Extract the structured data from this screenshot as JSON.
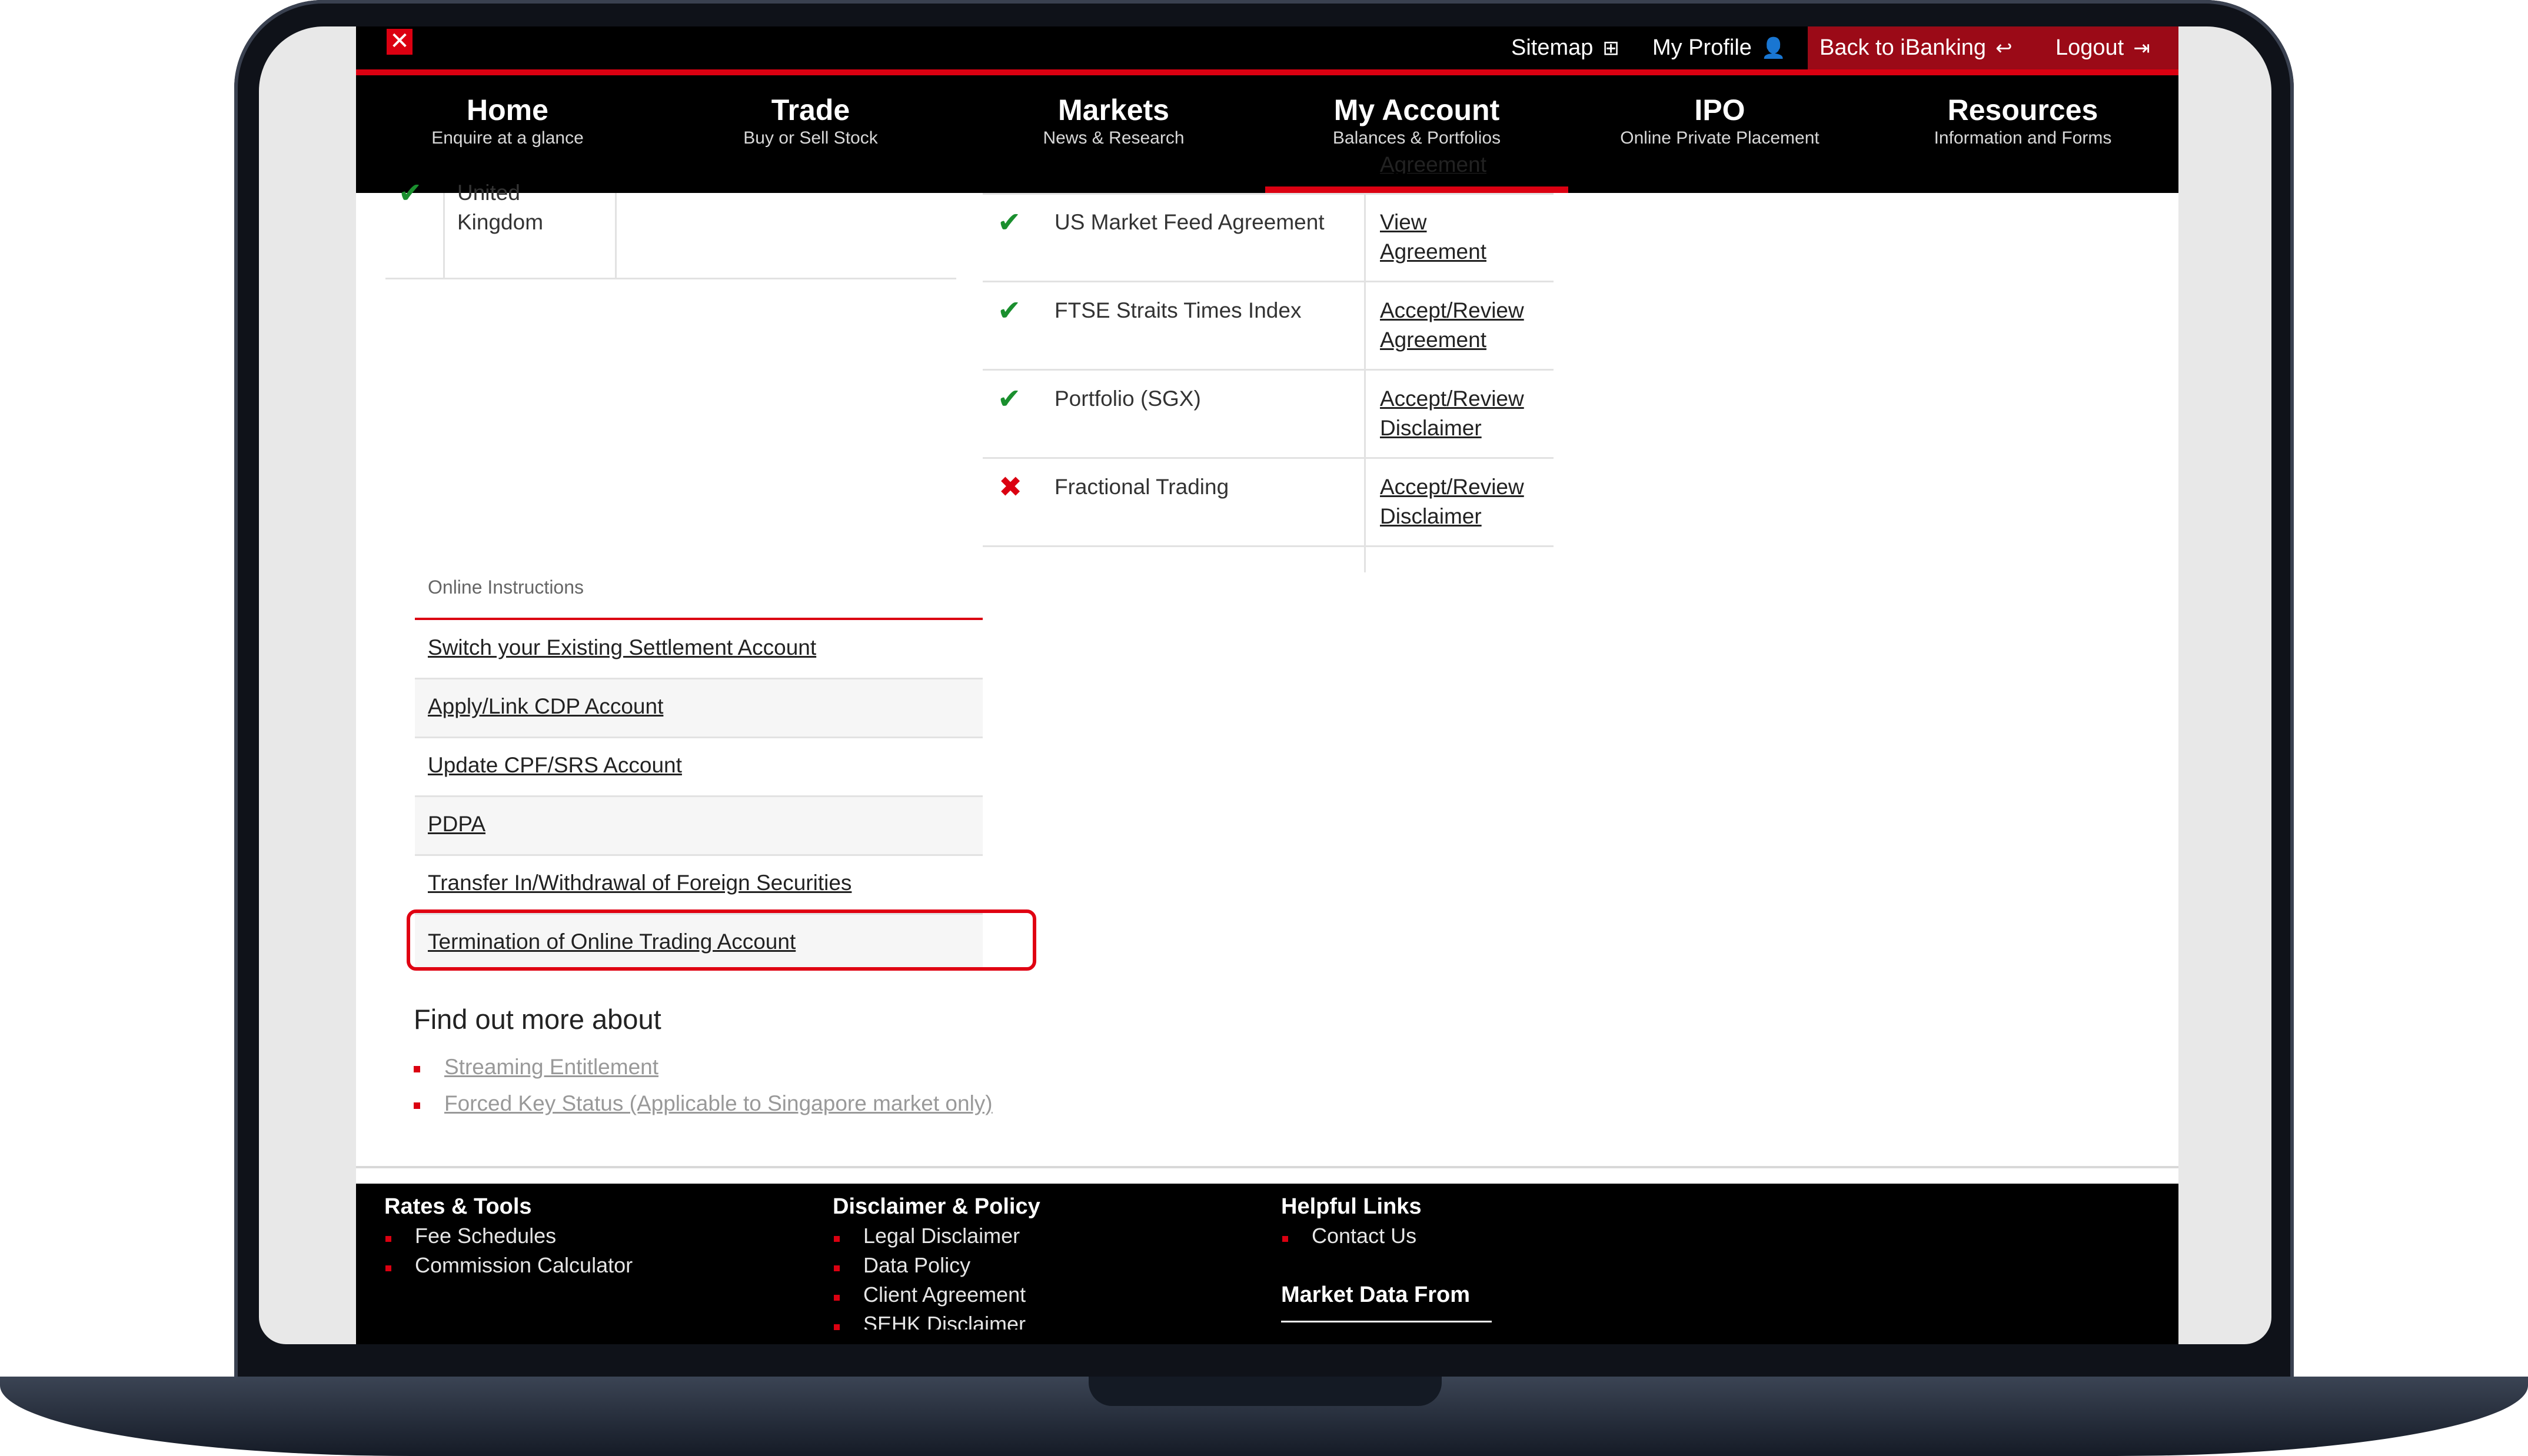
{
  "topbar": {
    "logo_icon": "hsbc-hexagon-icon",
    "sitemap": "Sitemap",
    "sitemap_icon": "sitemap-icon",
    "profile": "My Profile",
    "profile_icon": "user-icon",
    "back": "Back to iBanking",
    "back_icon": "reply-arrow-icon",
    "logout": "Logout",
    "logout_icon": "logout-icon"
  },
  "nav": [
    {
      "title": "Home",
      "subtitle": "Enquire at a glance"
    },
    {
      "title": "Trade",
      "subtitle": "Buy or Sell Stock"
    },
    {
      "title": "Markets",
      "subtitle": "News & Research"
    },
    {
      "title": "My Account",
      "subtitle": "Balances & Portfolios",
      "active": true
    },
    {
      "title": "IPO",
      "subtitle": "Online Private Placement"
    },
    {
      "title": "Resources",
      "subtitle": "Information and Forms"
    }
  ],
  "markets_partial": {
    "status": "check",
    "name_line1": "United",
    "name_line2": "Kingdom"
  },
  "agreements_partial_link": "Agreement",
  "agreements": [
    {
      "status": "check",
      "name": "US Market Feed Agreement",
      "link_line1": "View",
      "link_line2": "Agreement"
    },
    {
      "status": "check",
      "name": "FTSE Straits Times Index",
      "link_line1": "Accept/Review",
      "link_line2": "Agreement"
    },
    {
      "status": "check",
      "name": "Portfolio (SGX)",
      "link_line1": "Accept/Review",
      "link_line2": "Disclaimer"
    },
    {
      "status": "cross",
      "name": "Fractional Trading",
      "link_line1": "Accept/Review",
      "link_line2": "Disclaimer"
    }
  ],
  "online_instructions": {
    "heading": "Online Instructions",
    "items": [
      "Switch your Existing Settlement Account",
      "Apply/Link CDP Account",
      "Update CPF/SRS Account",
      "PDPA",
      "Transfer In/Withdrawal of Foreign Securities",
      "Termination of Online Trading Account"
    ]
  },
  "find_out_more": {
    "heading": "Find out more about",
    "items": [
      "Streaming Entitlement",
      "Forced Key Status (Applicable to Singapore market only)"
    ]
  },
  "footer": {
    "rates_heading": "Rates & Tools",
    "rates_items": [
      "Fee Schedules",
      "Commission Calculator"
    ],
    "policy_heading": "Disclaimer & Policy",
    "policy_items": [
      "Legal Disclaimer",
      "Data Policy",
      "Client Agreement",
      "SEHK Disclaimer"
    ],
    "helpful_heading": "Helpful Links",
    "helpful_items": [
      "Contact Us"
    ],
    "market_data_heading": "Market Data From"
  },
  "colors": {
    "brand_red": "#db0011",
    "check_green": "#1a8f2e",
    "highlight_red": "#e00012"
  }
}
